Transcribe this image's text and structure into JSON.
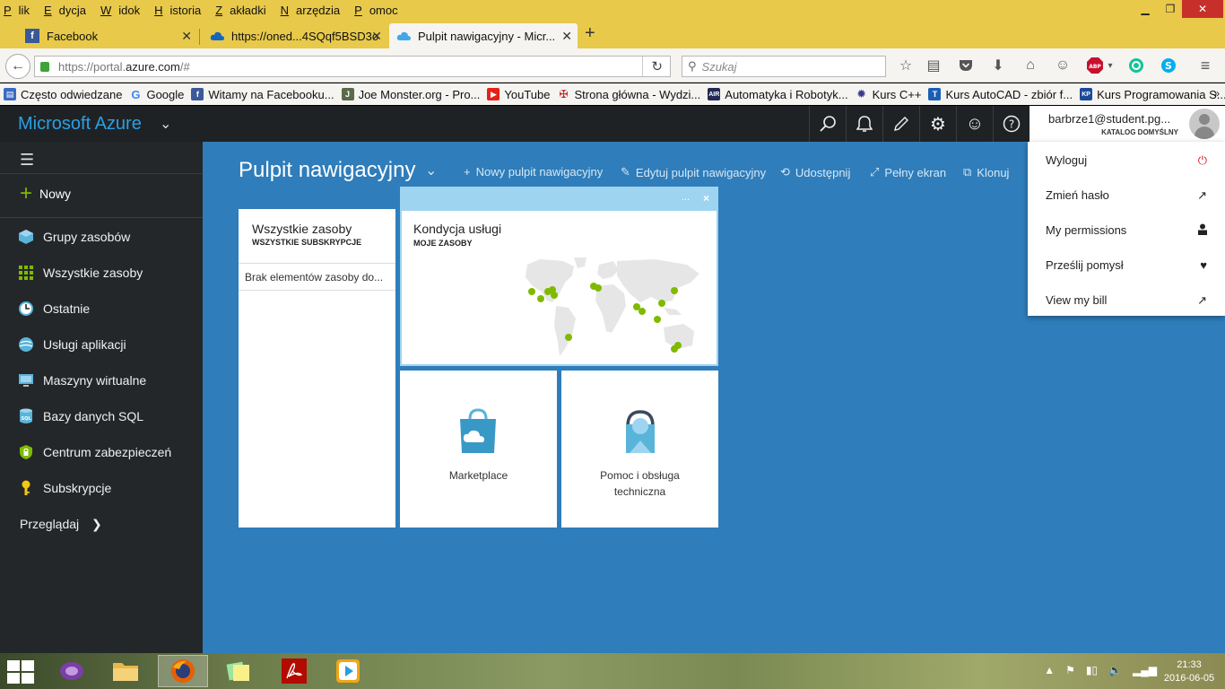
{
  "browser": {
    "menu": [
      {
        "underline": "P",
        "rest": "lik"
      },
      {
        "underline": "E",
        "rest": "dycja"
      },
      {
        "underline": "W",
        "rest": "idok"
      },
      {
        "underline": "H",
        "rest": "istoria"
      },
      {
        "underline": "Z",
        "rest": "akładki"
      },
      {
        "underline": "N",
        "rest": "arzędzia"
      },
      {
        "underline": "P",
        "rest": "omoc"
      }
    ],
    "tabs": [
      {
        "label": "Facebook",
        "icon": "facebook-icon"
      },
      {
        "label": "https://oned...4SQqf5BSD3o",
        "icon": "onedrive-icon"
      },
      {
        "label": "Pulpit nawigacyjny - Micr...",
        "icon": "azure-cloud-icon"
      }
    ],
    "url": {
      "scheme": "https://portal.",
      "host": "azure.com",
      "path": "/#"
    },
    "search_placeholder": "Szukaj",
    "bookmarks": [
      {
        "label": "Często odwiedzane",
        "icon": "bookmarks-folder-icon",
        "color": "#3a6bc4"
      },
      {
        "label": "Google",
        "icon": "google-icon",
        "color": "#ffffff"
      },
      {
        "label": "Witamy na Facebooku...",
        "icon": "facebook-icon",
        "color": "#3b5998"
      },
      {
        "label": "Joe Monster.org - Pro...",
        "icon": "joemonster-icon",
        "color": "#5a6a4a"
      },
      {
        "label": "YouTube",
        "icon": "youtube-icon",
        "color": "#e62117"
      },
      {
        "label": "Strona główna - Wydzi...",
        "icon": "university-icon",
        "color": "#c02020"
      },
      {
        "label": "Automatyka i Robotyk...",
        "icon": "air-icon",
        "color": "#222a55"
      },
      {
        "label": "Kurs C++",
        "icon": "gear-bookmark-icon",
        "color": "#3a3a90"
      },
      {
        "label": "Kurs AutoCAD - zbiór f...",
        "icon": "autocad-icon",
        "color": "#1a5fb4"
      },
      {
        "label": "Kurs Programowania S...",
        "icon": "course-icon",
        "color": "#1a4a9a"
      }
    ]
  },
  "portal": {
    "brand": "Microsoft Azure",
    "sidebar": {
      "new_label": "Nowy",
      "items": [
        {
          "label": "Grupy zasobów",
          "icon": "resource-groups-icon",
          "color": "#59b4d9"
        },
        {
          "label": "Wszystkie zasoby",
          "icon": "all-resources-icon",
          "color": "#7fba00"
        },
        {
          "label": "Ostatnie",
          "icon": "clock-icon",
          "color": "#59b4d9"
        },
        {
          "label": "Usługi aplikacji",
          "icon": "app-services-icon",
          "color": "#59b4d9"
        },
        {
          "label": "Maszyny wirtualne",
          "icon": "virtual-machine-icon",
          "color": "#59b4d9"
        },
        {
          "label": "Bazy danych SQL",
          "icon": "sql-database-icon",
          "color": "#59b4d9"
        },
        {
          "label": "Centrum zabezpieczeń",
          "icon": "security-shield-icon",
          "color": "#7fba00"
        },
        {
          "label": "Subskrypcje",
          "icon": "key-icon",
          "color": "#f2c811"
        }
      ],
      "browse_label": "Przeglądaj"
    },
    "dashboard": {
      "title": "Pulpit nawigacyjny",
      "commands": [
        {
          "label": "Nowy pulpit nawigacyjny",
          "icon": "plus-icon"
        },
        {
          "label": "Edytuj pulpit nawigacyjny",
          "icon": "pencil-icon"
        },
        {
          "label": "Udostępnij",
          "icon": "share-icon"
        },
        {
          "label": "Pełny ekran",
          "icon": "fullscreen-icon"
        },
        {
          "label": "Klonuj",
          "icon": "clone-icon"
        }
      ],
      "tiles": {
        "all_resources": {
          "title": "Wszystkie zasoby",
          "subtitle": "WSZYSTKIE SUBSKRYPCJE",
          "empty": "Brak elementów zasoby do..."
        },
        "service_health": {
          "title": "Kondycja usługi",
          "subtitle": "MOJE ZASOBY",
          "dots": "...",
          "close": "×"
        },
        "marketplace": {
          "label": "Marketplace"
        },
        "support": {
          "label": "Pomoc i obsługa techniczna"
        }
      }
    },
    "account": {
      "user": "barbrze1@student.pg...",
      "directory": "KATALOG DOMYŚLNY",
      "menu": [
        {
          "label": "Wyloguj",
          "icon": "power-icon",
          "icon_color": "#e81123"
        },
        {
          "label": "Zmień hasło",
          "icon": "external-link-icon",
          "icon_color": "#222222"
        },
        {
          "label": "My permissions",
          "icon": "person-icon",
          "icon_color": "#222222"
        },
        {
          "label": "Prześlij pomysł",
          "icon": "heart-icon",
          "icon_color": "#222222"
        },
        {
          "label": "View my bill",
          "icon": "external-link-icon",
          "icon_color": "#222222"
        }
      ]
    }
  },
  "taskbar": {
    "time": "21:33",
    "date": "2016-06-05"
  },
  "colors": {
    "azure_blue": "#2f7dba",
    "sidebar_bg": "#24272a",
    "accent_green": "#7fba00",
    "brand_text": "#2aa0e4"
  }
}
